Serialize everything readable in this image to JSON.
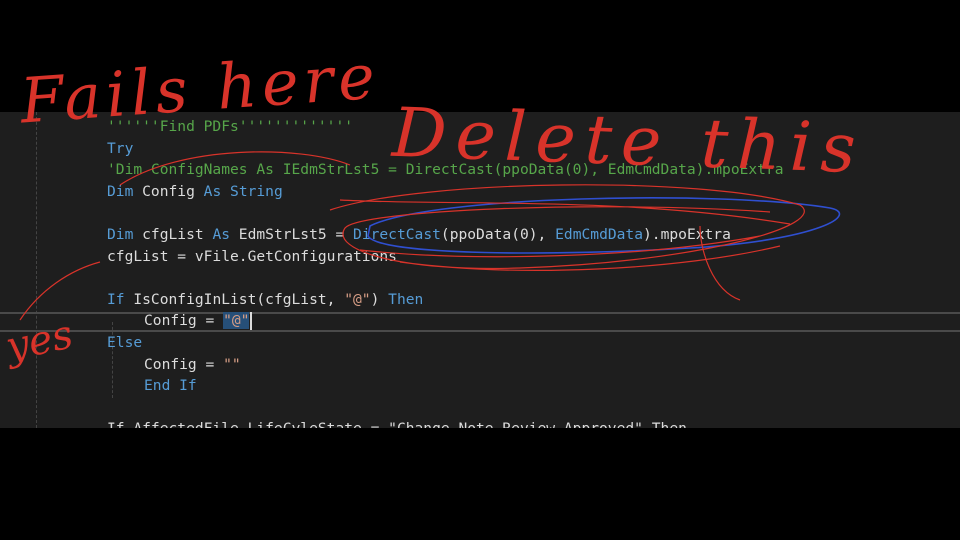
{
  "editor": {
    "lines": [
      {
        "indent": 0,
        "tokens": [
          {
            "t": "''''''Find PDFs'''''''''''''",
            "c": "cm"
          }
        ]
      },
      {
        "indent": 0,
        "tokens": [
          {
            "t": "Try",
            "c": "kw"
          }
        ]
      },
      {
        "indent": 0,
        "tokens": [
          {
            "t": "'Dim ConfigNames As IEdmStrLst5 = DirectCast(ppoData(0), EdmCmdData).mpoExtra",
            "c": "cm"
          }
        ]
      },
      {
        "indent": 0,
        "tokens": [
          {
            "t": "Dim",
            "c": "kw"
          },
          {
            "t": " Config ",
            "c": "tx"
          },
          {
            "t": "As",
            "c": "kw"
          },
          {
            "t": " ",
            "c": "tx"
          },
          {
            "t": "String",
            "c": "kw"
          }
        ]
      },
      {
        "indent": 0,
        "tokens": []
      },
      {
        "indent": 0,
        "tokens": [
          {
            "t": "Dim",
            "c": "kw"
          },
          {
            "t": " cfgList ",
            "c": "tx"
          },
          {
            "t": "As",
            "c": "kw"
          },
          {
            "t": " EdmStrLst5 = ",
            "c": "tx"
          },
          {
            "t": "DirectCast",
            "c": "kw"
          },
          {
            "t": "(ppoData(0), ",
            "c": "tx"
          },
          {
            "t": "EdmCmdData",
            "c": "kw"
          },
          {
            "t": ").mpoExtra",
            "c": "tx"
          }
        ]
      },
      {
        "indent": 0,
        "tokens": [
          {
            "t": "cfgList = vFile.GetConfigurations",
            "c": "tx"
          }
        ]
      },
      {
        "indent": 0,
        "tokens": []
      },
      {
        "indent": 0,
        "tokens": [
          {
            "t": "If",
            "c": "kw"
          },
          {
            "t": " IsConfigInList(cfgList, ",
            "c": "tx"
          },
          {
            "t": "\"@\"",
            "c": "str"
          },
          {
            "t": ") ",
            "c": "tx"
          },
          {
            "t": "Then",
            "c": "kw"
          }
        ]
      },
      {
        "indent": 1,
        "tokens": [
          {
            "t": "Config = ",
            "c": "tx"
          },
          {
            "t": "\"@\"",
            "c": "str",
            "sel": true
          }
        ],
        "caret": true
      },
      {
        "indent": 0,
        "tokens": [
          {
            "t": "Else",
            "c": "kw"
          }
        ]
      },
      {
        "indent": 1,
        "tokens": [
          {
            "t": "Config = ",
            "c": "tx"
          },
          {
            "t": "\"\"",
            "c": "str"
          }
        ]
      },
      {
        "indent": 1,
        "tokens": [
          {
            "t": "End If",
            "c": "kw"
          }
        ]
      },
      {
        "indent": 0,
        "tokens": []
      },
      {
        "indent": 0,
        "tokens": [
          {
            "t": "If AffectedFile.LifeCyleState = \"Change Note Review Approved\" Then",
            "c": "tx"
          }
        ]
      }
    ]
  },
  "annotations": {
    "fails_here": "Fails here",
    "delete_this": "Delete this",
    "yes": "yes"
  },
  "colors": {
    "ink_red": "#d8332a",
    "ink_blue": "#2f4fd0"
  }
}
